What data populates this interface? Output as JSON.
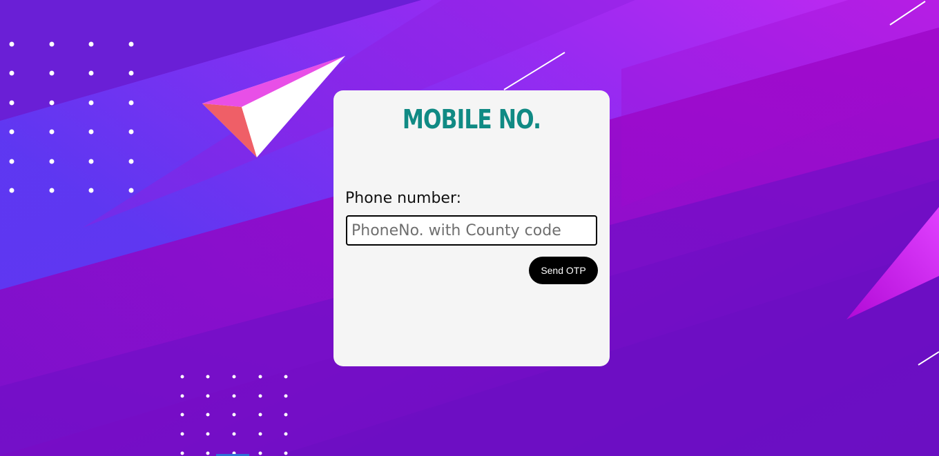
{
  "card": {
    "title": "MOBILE NO.",
    "phone_label": "Phone number:",
    "phone_input_placeholder": "PhoneNo. with County code",
    "phone_input_value": "",
    "send_button_label": "Send OTP"
  },
  "colors": {
    "background_primary": "#7b0fc8",
    "background_accent": "#c92cf5",
    "card_bg": "#f5f5f5",
    "title": "#108a84",
    "button_bg": "#000000",
    "button_text": "#ffffff"
  }
}
